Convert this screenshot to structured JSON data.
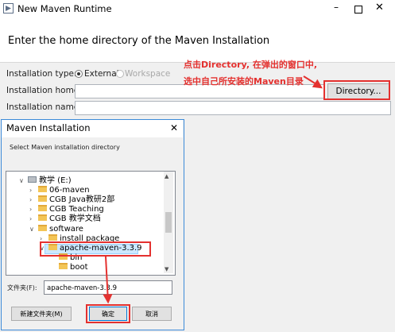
{
  "outer_window": {
    "title": "New Maven Runtime",
    "controls": {
      "minimize": "–",
      "close": "✕"
    },
    "header": "Enter the home directory of the Maven Installation",
    "installation_type_label": "Installation type:",
    "radio_external": "External",
    "radio_workspace": "Workspace",
    "selected_type": "External",
    "installation_home_label": "Installation home:",
    "installation_home_value": "",
    "installation_name_label": "Installation name:",
    "installation_name_value": "",
    "directory_button": "Directory..."
  },
  "annotations": {
    "line1": "点击Directory, 在弹出的窗口中,",
    "line2": "选中自己所安装的Maven目录",
    "color": "#e4312f"
  },
  "folder_dialog": {
    "title": "Maven Installation",
    "close": "✕",
    "description": "Select Maven installation directory",
    "tree": [
      {
        "label": "教学 (E:)",
        "level": 0,
        "expanded": true,
        "type": "drive"
      },
      {
        "label": "06-maven",
        "level": 1,
        "expanded": false,
        "type": "folder"
      },
      {
        "label": "CGB Java教研2部",
        "level": 1,
        "expanded": false,
        "type": "folder"
      },
      {
        "label": "CGB Teaching",
        "level": 1,
        "expanded": false,
        "type": "folder"
      },
      {
        "label": "CGB 教学文档",
        "level": 1,
        "expanded": false,
        "type": "folder"
      },
      {
        "label": "software",
        "level": 1,
        "expanded": true,
        "type": "folder"
      },
      {
        "label": "install package",
        "level": 2,
        "expanded": false,
        "type": "folder"
      },
      {
        "label": "apache-maven-3.3.9",
        "level": 2,
        "expanded": true,
        "type": "folder",
        "selected": true
      },
      {
        "label": "bin",
        "level": 3,
        "expanded": false,
        "type": "folder"
      },
      {
        "label": "boot",
        "level": 3,
        "expanded": false,
        "type": "folder"
      }
    ],
    "folder_label": "文件夹(F):",
    "folder_value": "apache-maven-3.3.9",
    "new_folder_button": "新建文件夹(M)",
    "ok_button": "确定",
    "cancel_button": "取消"
  }
}
